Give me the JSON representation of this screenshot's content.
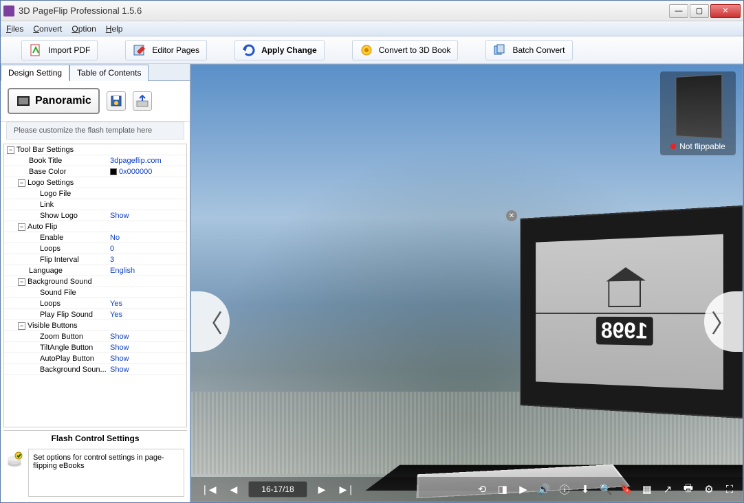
{
  "app": {
    "title": "3D PageFlip Professional 1.5.6"
  },
  "menu": {
    "files": "Files",
    "convert": "Convert",
    "option": "Option",
    "help": "Help"
  },
  "toolbar": {
    "import_pdf": "Import PDF",
    "editor_pages": "Editor Pages",
    "apply_change": "Apply Change",
    "convert_3d": "Convert to 3D Book",
    "batch_convert": "Batch Convert"
  },
  "tabs": {
    "design": "Design Setting",
    "toc": "Table of Contents"
  },
  "template": {
    "panoramic": "Panoramic",
    "customize_msg": "Please customize the flash template here"
  },
  "props": {
    "groups": {
      "toolbar_settings": "Tool Bar Settings",
      "logo_settings": "Logo Settings",
      "auto_flip": "Auto Flip",
      "background_sound": "Background Sound",
      "visible_buttons": "Visible Buttons"
    },
    "items": {
      "book_title": {
        "label": "Book Title",
        "value": "3dpageflip.com"
      },
      "base_color": {
        "label": "Base Color",
        "value": "0x000000"
      },
      "logo_file": {
        "label": "Logo File",
        "value": ""
      },
      "link": {
        "label": "Link",
        "value": ""
      },
      "show_logo": {
        "label": "Show Logo",
        "value": "Show"
      },
      "enable": {
        "label": "Enable",
        "value": "No"
      },
      "loops": {
        "label": "Loops",
        "value": "0"
      },
      "flip_interval": {
        "label": "Flip Interval",
        "value": "3"
      },
      "language": {
        "label": "Language",
        "value": "English"
      },
      "sound_file": {
        "label": "Sound File",
        "value": ""
      },
      "bs_loops": {
        "label": "Loops",
        "value": "Yes"
      },
      "play_flip_sound": {
        "label": "Play Flip Sound",
        "value": "Yes"
      },
      "zoom_button": {
        "label": "Zoom Button",
        "value": "Show"
      },
      "tilt_angle_button": {
        "label": "TiltAngle Button",
        "value": "Show"
      },
      "autoplay_button": {
        "label": "AutoPlay Button",
        "value": "Show"
      },
      "background_sound_btn": {
        "label": "Background Soun...",
        "value": "Show"
      }
    }
  },
  "footpanel": {
    "title": "Flash Control Settings",
    "text": "Set options for control settings in page-flipping eBooks"
  },
  "preview": {
    "page_counter": "16-17/18",
    "not_flippable": "Not flippable",
    "year": "1998"
  }
}
